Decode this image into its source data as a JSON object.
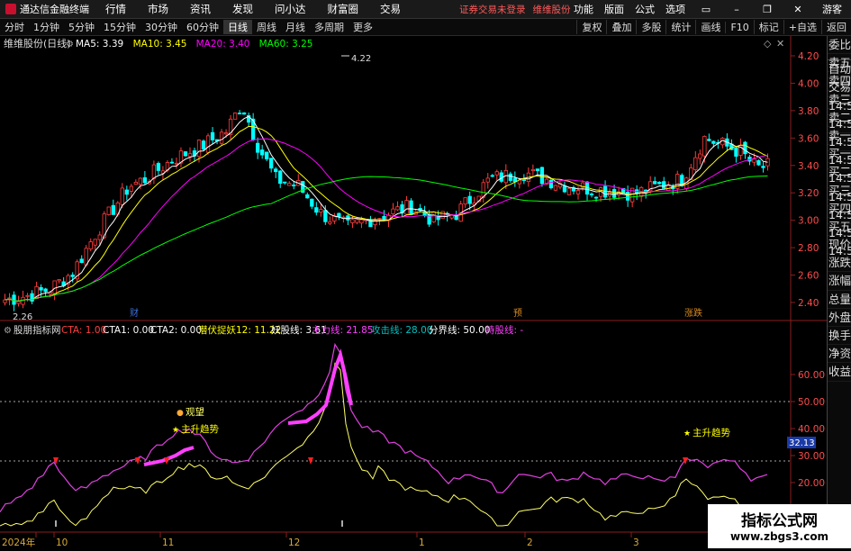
{
  "app": {
    "title": "通达信金融终端",
    "menu": [
      "行情",
      "市场",
      "资讯",
      "发现",
      "问小达",
      "财富圈",
      "交易"
    ],
    "notice": [
      "证券交易未登录",
      "维维股份"
    ],
    "right_menu": [
      "功能",
      "版面",
      "公式",
      "选项"
    ],
    "user": "游客"
  },
  "periods": [
    "分时",
    "1分钟",
    "5分钟",
    "15分钟",
    "30分钟",
    "60分钟",
    "日线",
    "周线",
    "月线",
    "多周期",
    "更多"
  ],
  "active_period": "日线",
  "tools": [
    "复权",
    "叠加",
    "多股",
    "统计",
    "画线",
    "F10",
    "标记",
    "+自选",
    "返回"
  ],
  "sidebar_tabs": [
    "委比",
    "卖五",
    "卖四",
    "卖三",
    "卖二",
    "卖一",
    "买一",
    "买二",
    "买三",
    "买四",
    "买五",
    "现价",
    "涨跌",
    "涨幅",
    "总量",
    "外盘",
    "换手",
    "净资",
    "收益"
  ],
  "sidebar_lower": {
    "btn1": "自动",
    "btn2": "交易",
    "times": [
      "14:56",
      "14:56",
      "14:56",
      "14:56",
      "14:56",
      "14:56",
      "14:56",
      "14:56",
      "14:56"
    ]
  },
  "main_chart": {
    "title": "维维股份(日线)",
    "ma": [
      {
        "label": "MA5: 3.39",
        "color": "#ffffff"
      },
      {
        "label": "MA10: 3.45",
        "color": "#ffff00"
      },
      {
        "label": "MA20: 3.40",
        "color": "#ff00ff"
      },
      {
        "label": "MA60: 3.25",
        "color": "#00ff00"
      }
    ],
    "y_ticks": [
      "4.20",
      "4.00",
      "3.80",
      "3.60",
      "3.40",
      "3.20",
      "3.00",
      "2.80",
      "2.60",
      "2.40"
    ],
    "high_label": "4.22",
    "low_label": "2.26",
    "markers": [
      "财",
      "预",
      "涨跌"
    ]
  },
  "indicator": {
    "name": "股朋指标网",
    "fields": [
      {
        "label": "CTA: 1.00",
        "color": "#ff4040"
      },
      {
        "label": "CTA1: 0.00",
        "color": "#ffffff"
      },
      {
        "label": "CTA2: 0.00",
        "color": "#ffffff"
      },
      {
        "label": "潜伏捉妖12: 11.22",
        "color": "#ffff00"
      },
      {
        "label": "妖股线: 3.61",
        "color": "#ffffff"
      },
      {
        "label": "主力线: 21.85",
        "color": "#ff40ff"
      },
      {
        "label": "攻击线: 28.00",
        "color": "#00c0c0"
      },
      {
        "label": "分界线: 50.00",
        "color": "#ffffff"
      },
      {
        "label": "持股线: -",
        "color": "#ff40ff"
      }
    ],
    "y_ticks": [
      "60.00",
      "50.00",
      "40.00",
      "30.00",
      "20.00"
    ],
    "current_value": "32.13",
    "annotations": [
      "观望",
      "主升趋势",
      "主升趋势"
    ]
  },
  "x_labels": [
    "2024年",
    "10",
    "11",
    "12",
    "1",
    "2",
    "3"
  ],
  "watermark": {
    "line1": "指标公式网",
    "line2": "www.zbgs3.com"
  }
}
